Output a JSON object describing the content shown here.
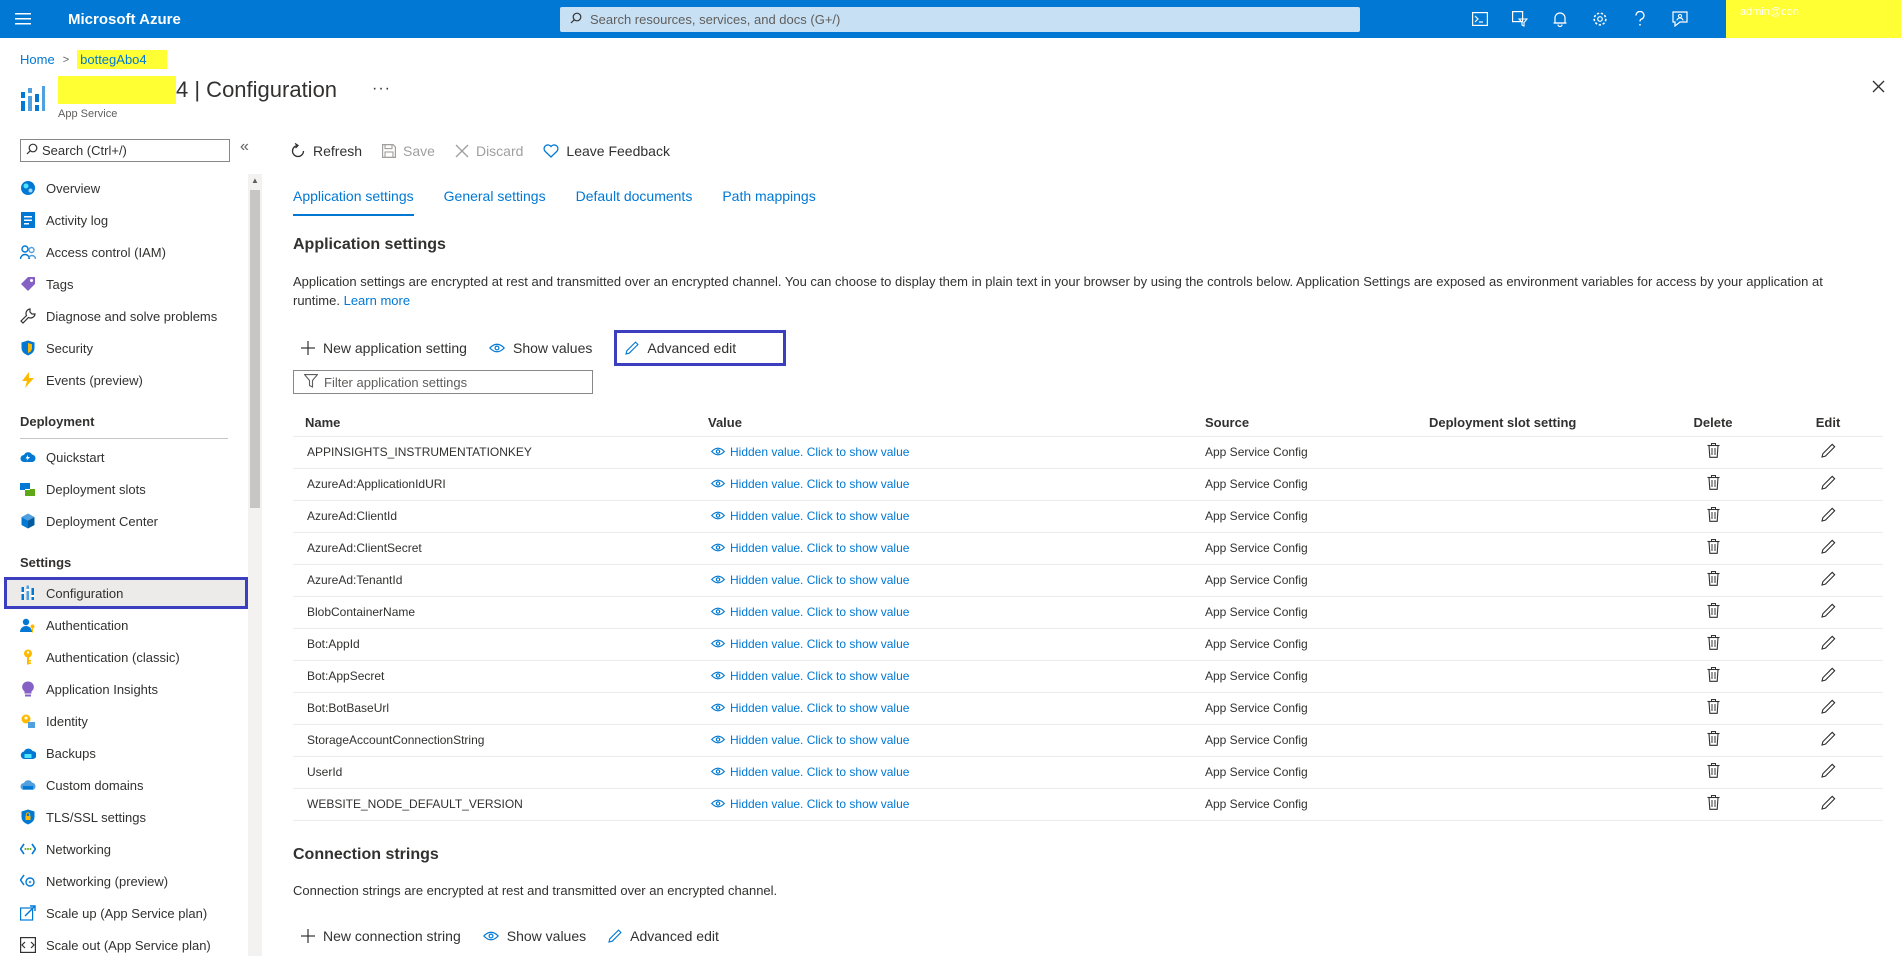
{
  "topbar": {
    "brand": "Microsoft Azure",
    "search_placeholder": "Search resources, services, and docs (G+/)",
    "account_text": "admin@con"
  },
  "breadcrumb": {
    "home": "Home",
    "app": "bottegAbo4"
  },
  "resource": {
    "name_suffix": "4 | Configuration",
    "subtitle": "App Service",
    "more": "···"
  },
  "sidebar": {
    "search_placeholder": "Search (Ctrl+/)",
    "collapse": "«",
    "top_items": [
      {
        "label": "Overview",
        "icon": "globe-icon"
      },
      {
        "label": "Activity log",
        "icon": "log-icon"
      },
      {
        "label": "Access control (IAM)",
        "icon": "people-icon"
      },
      {
        "label": "Tags",
        "icon": "tag-icon"
      },
      {
        "label": "Diagnose and solve problems",
        "icon": "wrench-icon"
      },
      {
        "label": "Security",
        "icon": "shield-icon"
      },
      {
        "label": "Events (preview)",
        "icon": "lightning-icon"
      }
    ],
    "deployment_group": "Deployment",
    "deployment_items": [
      {
        "label": "Quickstart",
        "icon": "cloud-icon"
      },
      {
        "label": "Deployment slots",
        "icon": "slots-icon"
      },
      {
        "label": "Deployment Center",
        "icon": "cube-icon"
      }
    ],
    "settings_group": "Settings",
    "settings_items": [
      {
        "label": "Configuration",
        "icon": "config-icon",
        "active": true
      },
      {
        "label": "Authentication",
        "icon": "user-key-icon"
      },
      {
        "label": "Authentication (classic)",
        "icon": "key-icon"
      },
      {
        "label": "Application Insights",
        "icon": "bulb-icon"
      },
      {
        "label": "Identity",
        "icon": "identity-icon"
      },
      {
        "label": "Backups",
        "icon": "backup-icon"
      },
      {
        "label": "Custom domains",
        "icon": "domain-icon"
      },
      {
        "label": "TLS/SSL settings",
        "icon": "tls-icon"
      },
      {
        "label": "Networking",
        "icon": "network-icon"
      },
      {
        "label": "Networking (preview)",
        "icon": "network-preview-icon"
      },
      {
        "label": "Scale up (App Service plan)",
        "icon": "scale-up-icon"
      },
      {
        "label": "Scale out (App Service plan)",
        "icon": "scale-out-icon"
      }
    ]
  },
  "commands": {
    "refresh": "Refresh",
    "save": "Save",
    "discard": "Discard",
    "feedback": "Leave Feedback"
  },
  "tabs": [
    {
      "label": "Application settings",
      "active": true
    },
    {
      "label": "General settings"
    },
    {
      "label": "Default documents"
    },
    {
      "label": "Path mappings"
    }
  ],
  "app_settings": {
    "title": "Application settings",
    "description": "Application settings are encrypted at rest and transmitted over an encrypted channel. You can choose to display them in plain text in your browser by using the controls below. Application Settings are exposed as environment variables for access by your application at runtime.",
    "learn_more": "Learn more",
    "new_label": "New application setting",
    "show_values": "Show values",
    "advanced_edit": "Advanced edit",
    "filter_placeholder": "Filter application settings",
    "columns": {
      "name": "Name",
      "value": "Value",
      "source": "Source",
      "slot": "Deployment slot setting",
      "delete": "Delete",
      "edit": "Edit"
    },
    "rows": [
      {
        "name": "APPINSIGHTS_INSTRUMENTATIONKEY",
        "value": "Hidden value. Click to show value",
        "source": "App Service Config"
      },
      {
        "name": "AzureAd:ApplicationIdURI",
        "value": "Hidden value. Click to show value",
        "source": "App Service Config"
      },
      {
        "name": "AzureAd:ClientId",
        "value": "Hidden value. Click to show value",
        "source": "App Service Config"
      },
      {
        "name": "AzureAd:ClientSecret",
        "value": "Hidden value. Click to show value",
        "source": "App Service Config"
      },
      {
        "name": "AzureAd:TenantId",
        "value": "Hidden value. Click to show value",
        "source": "App Service Config"
      },
      {
        "name": "BlobContainerName",
        "value": "Hidden value. Click to show value",
        "source": "App Service Config"
      },
      {
        "name": "Bot:AppId",
        "value": "Hidden value. Click to show value",
        "source": "App Service Config"
      },
      {
        "name": "Bot:AppSecret",
        "value": "Hidden value. Click to show value",
        "source": "App Service Config"
      },
      {
        "name": "Bot:BotBaseUrl",
        "value": "Hidden value. Click to show value",
        "source": "App Service Config"
      },
      {
        "name": "StorageAccountConnectionString",
        "value": "Hidden value. Click to show value",
        "source": "App Service Config"
      },
      {
        "name": "UserId",
        "value": "Hidden value. Click to show value",
        "source": "App Service Config"
      },
      {
        "name": "WEBSITE_NODE_DEFAULT_VERSION",
        "value": "Hidden value. Click to show value",
        "source": "App Service Config"
      }
    ]
  },
  "conn_strings": {
    "title": "Connection strings",
    "description": "Connection strings are encrypted at rest and transmitted over an encrypted channel.",
    "new_label": "New connection string",
    "show_values": "Show values",
    "advanced_edit": "Advanced edit"
  },
  "colors": {
    "azure_blue": "#0078d4",
    "highlight_box": "#3b3fbf",
    "redaction_yellow": "#ffff33"
  }
}
